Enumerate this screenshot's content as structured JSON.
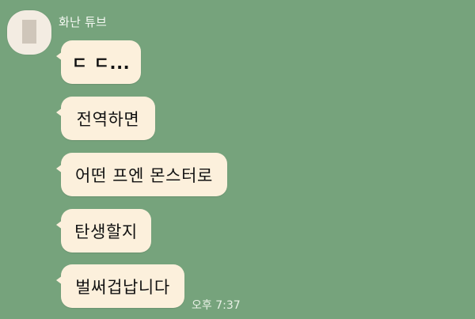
{
  "chat": {
    "sender": {
      "name": "화난 튜브"
    },
    "messages": [
      {
        "text": "ㄷ ㄷ..."
      },
      {
        "text": "전역하면"
      },
      {
        "text": "어떤 프엔 몬스터로"
      },
      {
        "text": "탄생할지"
      },
      {
        "text": "벌써겁납니다"
      }
    ],
    "timestamp": "오후 7:37"
  },
  "colors": {
    "background": "#76a37c",
    "bubble": "#fcf0dc",
    "avatar": "#f3ece2"
  }
}
